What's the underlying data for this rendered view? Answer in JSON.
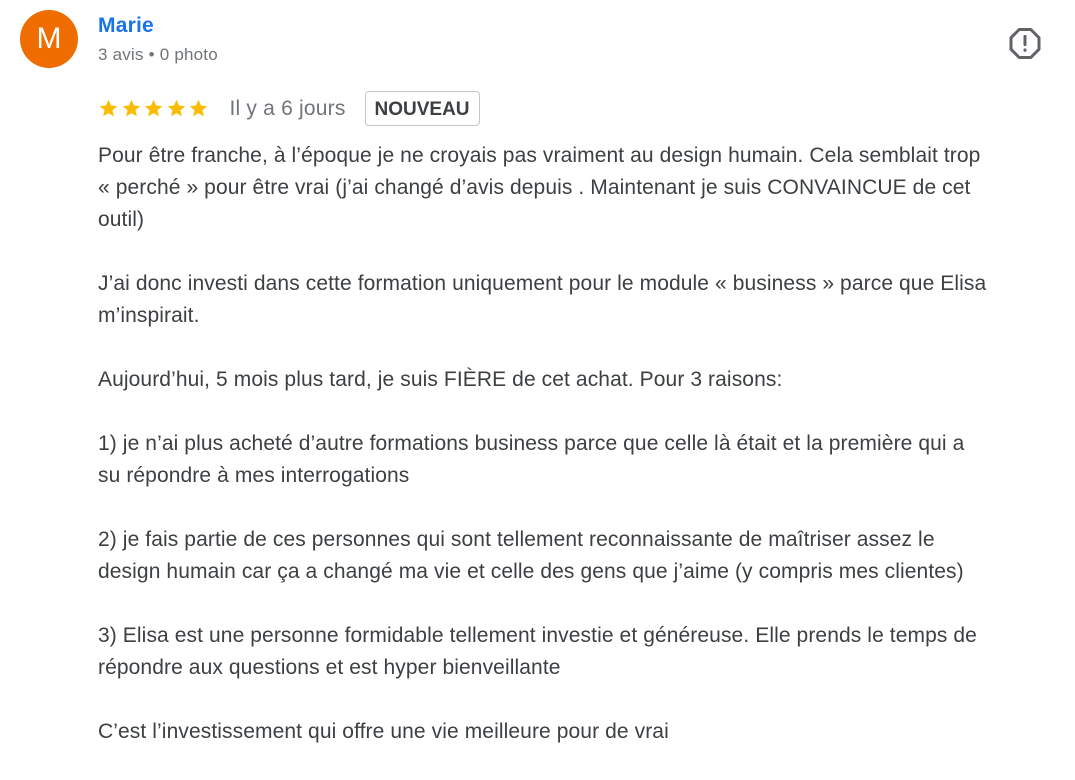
{
  "reviewer": {
    "initial": "M",
    "avatar_color": "#ef6c00",
    "name": "Marie",
    "review_count": "3 avis",
    "separator": "•",
    "photo_count": "0 photo"
  },
  "report": {
    "icon": "flag-report-icon"
  },
  "rating": {
    "stars": 5,
    "max_stars": 5,
    "star_color": "#fbbc04",
    "date": "Il y a 6 jours",
    "badge": "NOUVEAU"
  },
  "review_text": {
    "p1": {
      "l1": "Pour être franche, à l’époque je ne croyais pas vraiment au design humain. Cela semblait trop",
      "l2": "« perché » pour être vrai (j’ai changé d’avis depuis . Maintenant je suis CONVAINCUE de cet",
      "l3": "outil)"
    },
    "p2": {
      "l1": "J’ai donc investi dans cette formation uniquement pour le module « business » parce que Elisa",
      "l2": "m’inspirait."
    },
    "p3": {
      "l1": "Aujourd’hui, 5 mois plus tard, je suis FIÈRE de cet achat. Pour 3 raisons:"
    },
    "p4": {
      "l1": "1) je n’ai plus acheté d’autre formations business parce que celle là était et la première qui a",
      "l2": "su répondre à mes interrogations"
    },
    "p5": {
      "l1": "2) je fais partie de ces personnes qui sont tellement reconnaissante de maîtriser assez le",
      "l2": "design humain car ça a changé ma vie et celle des gens que j’aime (y compris mes clientes)"
    },
    "p6": {
      "l1": "3) Elisa est une personne formidable tellement investie et généreuse. Elle prends le temps de",
      "l2": "répondre aux questions et est hyper bienveillante"
    },
    "p7": {
      "l1": "C’est l’investissement qui offre une vie meilleure pour de vrai"
    }
  }
}
